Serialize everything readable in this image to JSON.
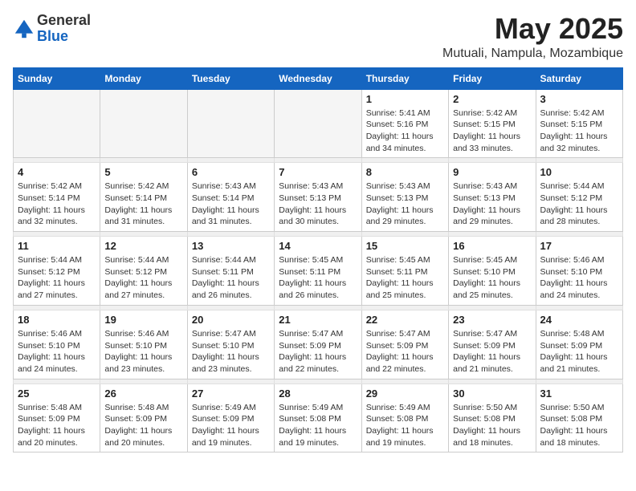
{
  "logo": {
    "general": "General",
    "blue": "Blue"
  },
  "title": "May 2025",
  "location": "Mutuali, Nampula, Mozambique",
  "days_of_week": [
    "Sunday",
    "Monday",
    "Tuesday",
    "Wednesday",
    "Thursday",
    "Friday",
    "Saturday"
  ],
  "weeks": [
    [
      {
        "day": "",
        "info": ""
      },
      {
        "day": "",
        "info": ""
      },
      {
        "day": "",
        "info": ""
      },
      {
        "day": "",
        "info": ""
      },
      {
        "day": "1",
        "info": "Sunrise: 5:41 AM\nSunset: 5:16 PM\nDaylight: 11 hours\nand 34 minutes."
      },
      {
        "day": "2",
        "info": "Sunrise: 5:42 AM\nSunset: 5:15 PM\nDaylight: 11 hours\nand 33 minutes."
      },
      {
        "day": "3",
        "info": "Sunrise: 5:42 AM\nSunset: 5:15 PM\nDaylight: 11 hours\nand 32 minutes."
      }
    ],
    [
      {
        "day": "4",
        "info": "Sunrise: 5:42 AM\nSunset: 5:14 PM\nDaylight: 11 hours\nand 32 minutes."
      },
      {
        "day": "5",
        "info": "Sunrise: 5:42 AM\nSunset: 5:14 PM\nDaylight: 11 hours\nand 31 minutes."
      },
      {
        "day": "6",
        "info": "Sunrise: 5:43 AM\nSunset: 5:14 PM\nDaylight: 11 hours\nand 31 minutes."
      },
      {
        "day": "7",
        "info": "Sunrise: 5:43 AM\nSunset: 5:13 PM\nDaylight: 11 hours\nand 30 minutes."
      },
      {
        "day": "8",
        "info": "Sunrise: 5:43 AM\nSunset: 5:13 PM\nDaylight: 11 hours\nand 29 minutes."
      },
      {
        "day": "9",
        "info": "Sunrise: 5:43 AM\nSunset: 5:13 PM\nDaylight: 11 hours\nand 29 minutes."
      },
      {
        "day": "10",
        "info": "Sunrise: 5:44 AM\nSunset: 5:12 PM\nDaylight: 11 hours\nand 28 minutes."
      }
    ],
    [
      {
        "day": "11",
        "info": "Sunrise: 5:44 AM\nSunset: 5:12 PM\nDaylight: 11 hours\nand 27 minutes."
      },
      {
        "day": "12",
        "info": "Sunrise: 5:44 AM\nSunset: 5:12 PM\nDaylight: 11 hours\nand 27 minutes."
      },
      {
        "day": "13",
        "info": "Sunrise: 5:44 AM\nSunset: 5:11 PM\nDaylight: 11 hours\nand 26 minutes."
      },
      {
        "day": "14",
        "info": "Sunrise: 5:45 AM\nSunset: 5:11 PM\nDaylight: 11 hours\nand 26 minutes."
      },
      {
        "day": "15",
        "info": "Sunrise: 5:45 AM\nSunset: 5:11 PM\nDaylight: 11 hours\nand 25 minutes."
      },
      {
        "day": "16",
        "info": "Sunrise: 5:45 AM\nSunset: 5:10 PM\nDaylight: 11 hours\nand 25 minutes."
      },
      {
        "day": "17",
        "info": "Sunrise: 5:46 AM\nSunset: 5:10 PM\nDaylight: 11 hours\nand 24 minutes."
      }
    ],
    [
      {
        "day": "18",
        "info": "Sunrise: 5:46 AM\nSunset: 5:10 PM\nDaylight: 11 hours\nand 24 minutes."
      },
      {
        "day": "19",
        "info": "Sunrise: 5:46 AM\nSunset: 5:10 PM\nDaylight: 11 hours\nand 23 minutes."
      },
      {
        "day": "20",
        "info": "Sunrise: 5:47 AM\nSunset: 5:10 PM\nDaylight: 11 hours\nand 23 minutes."
      },
      {
        "day": "21",
        "info": "Sunrise: 5:47 AM\nSunset: 5:09 PM\nDaylight: 11 hours\nand 22 minutes."
      },
      {
        "day": "22",
        "info": "Sunrise: 5:47 AM\nSunset: 5:09 PM\nDaylight: 11 hours\nand 22 minutes."
      },
      {
        "day": "23",
        "info": "Sunrise: 5:47 AM\nSunset: 5:09 PM\nDaylight: 11 hours\nand 21 minutes."
      },
      {
        "day": "24",
        "info": "Sunrise: 5:48 AM\nSunset: 5:09 PM\nDaylight: 11 hours\nand 21 minutes."
      }
    ],
    [
      {
        "day": "25",
        "info": "Sunrise: 5:48 AM\nSunset: 5:09 PM\nDaylight: 11 hours\nand 20 minutes."
      },
      {
        "day": "26",
        "info": "Sunrise: 5:48 AM\nSunset: 5:09 PM\nDaylight: 11 hours\nand 20 minutes."
      },
      {
        "day": "27",
        "info": "Sunrise: 5:49 AM\nSunset: 5:09 PM\nDaylight: 11 hours\nand 19 minutes."
      },
      {
        "day": "28",
        "info": "Sunrise: 5:49 AM\nSunset: 5:08 PM\nDaylight: 11 hours\nand 19 minutes."
      },
      {
        "day": "29",
        "info": "Sunrise: 5:49 AM\nSunset: 5:08 PM\nDaylight: 11 hours\nand 19 minutes."
      },
      {
        "day": "30",
        "info": "Sunrise: 5:50 AM\nSunset: 5:08 PM\nDaylight: 11 hours\nand 18 minutes."
      },
      {
        "day": "31",
        "info": "Sunrise: 5:50 AM\nSunset: 5:08 PM\nDaylight: 11 hours\nand 18 minutes."
      }
    ]
  ]
}
